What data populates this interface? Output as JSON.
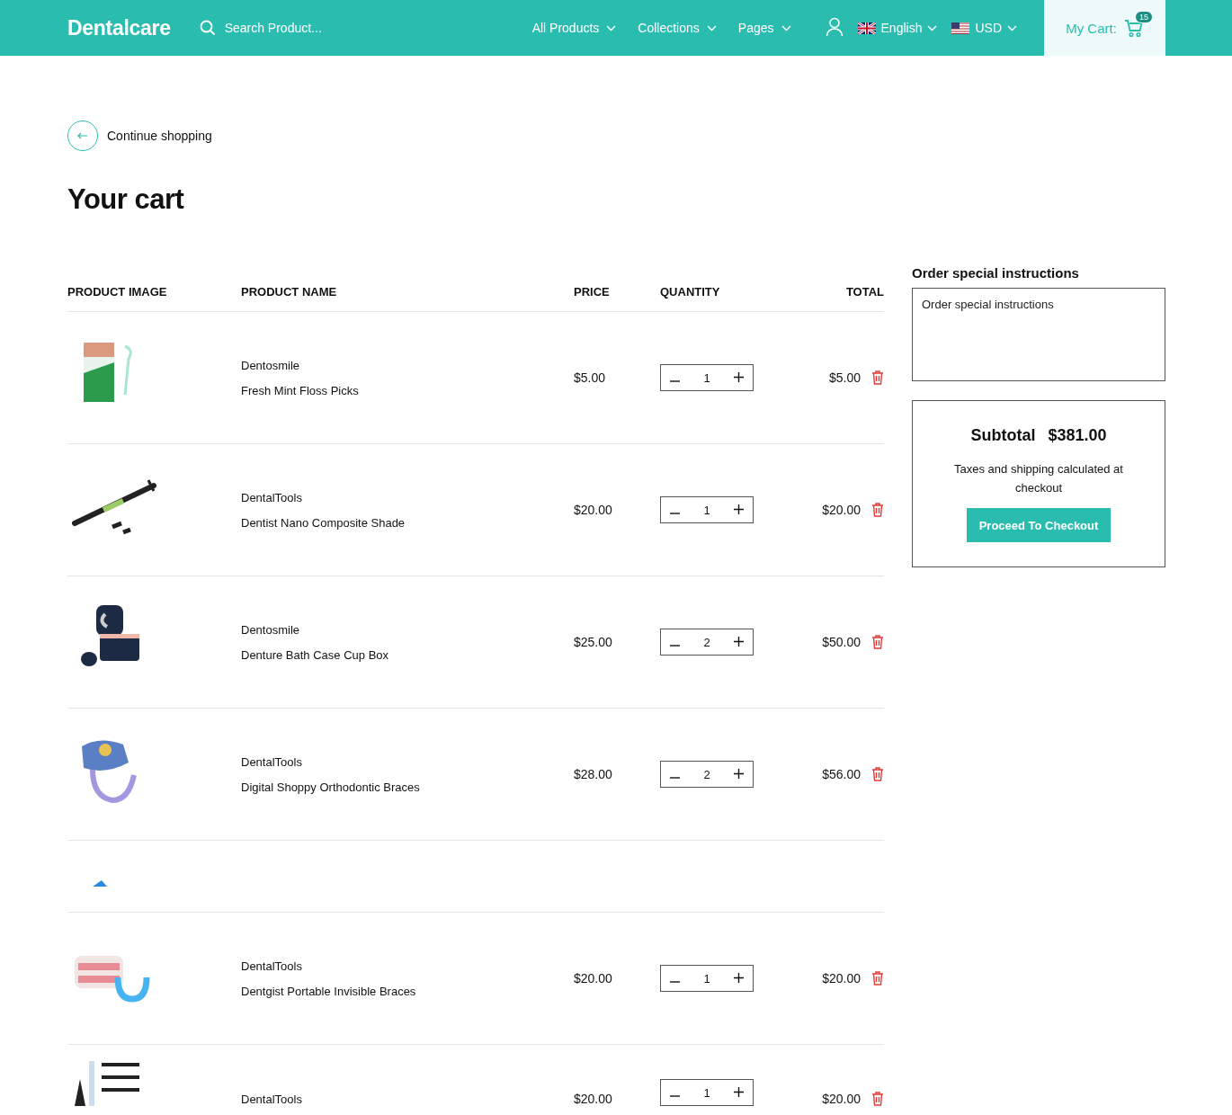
{
  "header": {
    "logo": "Dentalcare",
    "search": {
      "placeholder": "Search Product..."
    },
    "nav": [
      {
        "label": "All Products"
      },
      {
        "label": "Collections"
      },
      {
        "label": "Pages"
      }
    ],
    "language": "English",
    "currency": "USD",
    "cart": {
      "label": "My Cart:",
      "count": "15"
    }
  },
  "back_link": "Continue shopping",
  "title": "Your cart",
  "table": {
    "columns": [
      "PRODUCT IMAGE",
      "PRODUCT NAME",
      "PRICE",
      "QUANTITY",
      "TOTAL"
    ],
    "rows": [
      {
        "kind": "product",
        "vendor": "Dentosmile",
        "name": "Fresh Mint Floss Picks",
        "price": "$5.00",
        "quantity": "1",
        "total": "$5.00"
      },
      {
        "kind": "product",
        "vendor": "DentalTools",
        "name": "Dentist Nano Composite Shade",
        "price": "$20.00",
        "quantity": "1",
        "total": "$20.00"
      },
      {
        "kind": "product",
        "vendor": "Dentosmile",
        "name": "Denture Bath Case Cup Box",
        "price": "$25.00",
        "quantity": "2",
        "total": "$50.00"
      },
      {
        "kind": "product",
        "vendor": "DentalTools",
        "name": "Digital Shoppy Orthodontic Braces",
        "price": "$28.00",
        "quantity": "2",
        "total": "$56.00"
      },
      {
        "kind": "image_only"
      },
      {
        "kind": "product",
        "vendor": "DentalTools",
        "name": "Dentgist Portable Invisible Braces",
        "price": "$20.00",
        "quantity": "1",
        "total": "$20.00"
      },
      {
        "kind": "product",
        "vendor": "DentalTools",
        "price": "$20.00",
        "quantity": "1",
        "total": "$20.00"
      }
    ]
  },
  "instructions": {
    "title": "Order special instructions",
    "placeholder": "Order special instructions"
  },
  "summary": {
    "label": "Subtotal",
    "amount": "$381.00",
    "note": "Taxes and shipping calculated at checkout",
    "button": "Proceed To Checkout"
  }
}
